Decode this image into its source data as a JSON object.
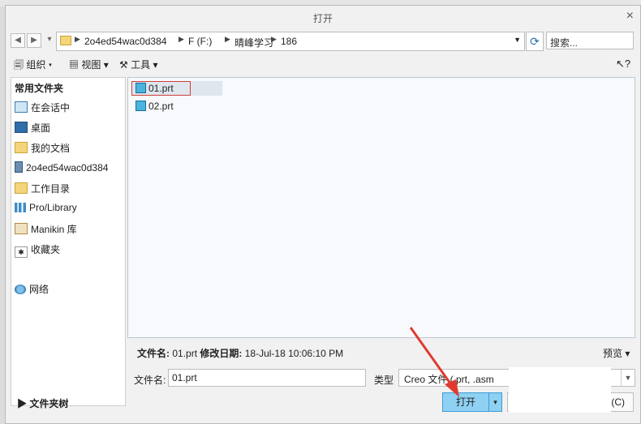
{
  "window": {
    "title": "打开",
    "close_label": "×"
  },
  "address_bar": {
    "segments": [
      "2o4ed54wac0d384",
      "F (F:)",
      "晴峰学习",
      "186"
    ]
  },
  "search": {
    "placeholder": "搜索..."
  },
  "toolbar": {
    "organize": "组织",
    "view": "视图",
    "tools": "工具"
  },
  "sidebar": {
    "heading": "常用文件夹",
    "items": [
      {
        "label": "在会话中",
        "icon": "monitor-icon"
      },
      {
        "label": "桌面",
        "icon": "desktop-icon"
      },
      {
        "label": "我的文档",
        "icon": "documents-icon"
      },
      {
        "label": "2o4ed54wac0d384",
        "icon": "computer-icon"
      },
      {
        "label": "工作目录",
        "icon": "working-folder-icon"
      },
      {
        "label": "Pro/Library",
        "icon": "library-icon"
      },
      {
        "label": "Manikin 库",
        "icon": "manikin-library-icon"
      },
      {
        "label": "收藏夹",
        "icon": "favorites-icon"
      },
      {
        "label": "网络",
        "icon": "network-icon"
      }
    ]
  },
  "files": [
    {
      "name": "01.prt",
      "selected": true
    },
    {
      "name": "02.prt",
      "selected": false
    }
  ],
  "info": {
    "filename_label": "文件名:",
    "filename": "01.prt",
    "modified_label": "修改日期:",
    "modified": "18-Jul-18 10:06:10 PM",
    "preview": "预览"
  },
  "form": {
    "filename_label": "文件名:",
    "filename_value": "01.prt",
    "type_label": "类型",
    "type_value": "Creo 文件 (.prt, .asm"
  },
  "folder_tree_label": "文件夹树",
  "buttons": {
    "open": "打开",
    "cancel": "取消(C)"
  },
  "colors": {
    "open_button": "#8ed1f3",
    "selection_outline": "#d0403a",
    "annotation_arrow": "#e03a2f"
  }
}
